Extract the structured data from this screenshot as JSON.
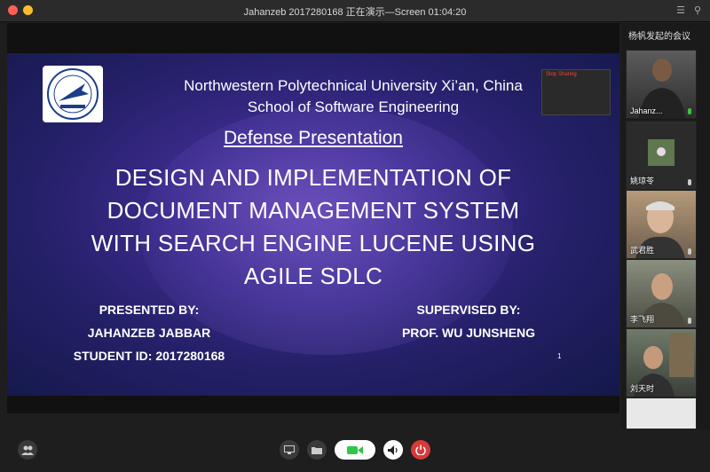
{
  "window": {
    "title": "Jahanzeb 2017280168 正在演示—Screen 01:04:20"
  },
  "slide": {
    "university_line1": "Northwestern Polytechnical University Xi’an, China",
    "university_line2": "School of Software Engineering",
    "heading": "Defense Presentation",
    "thesis_lines": [
      "DESIGN AND IMPLEMENTATION OF",
      "DOCUMENT MANAGEMENT SYSTEM",
      "WITH SEARCH ENGINE LUCENE USING",
      "AGILE SDLC"
    ],
    "presented_label": "PRESENTED BY:",
    "presenter_name": "JAHANZEB JABBAR",
    "student_id": "STUDENT ID: 2017280168",
    "supervised_label": "SUPERVISED BY:",
    "supervisor_name": "PROF. WU JUNSHENG",
    "page_number": "1",
    "sharing_thumb_label": "Stop Sharing"
  },
  "sidebar": {
    "title": "杨帆发起的会议",
    "participants": [
      {
        "name": "Jahanz...",
        "mic": "#3ec23e"
      },
      {
        "name": "姚琼苓",
        "mic": "#cccccc"
      },
      {
        "name": "武君胜",
        "mic": "#cccccc"
      },
      {
        "name": "李飞翔",
        "mic": "#cccccc"
      },
      {
        "name": "刘天时",
        "mic": "#cccccc"
      }
    ]
  },
  "colors": {
    "accent_green": "#2fc64a",
    "end_red": "#d83a3a",
    "mac_red": "#ff5f57",
    "mac_yellow": "#febc2e"
  }
}
